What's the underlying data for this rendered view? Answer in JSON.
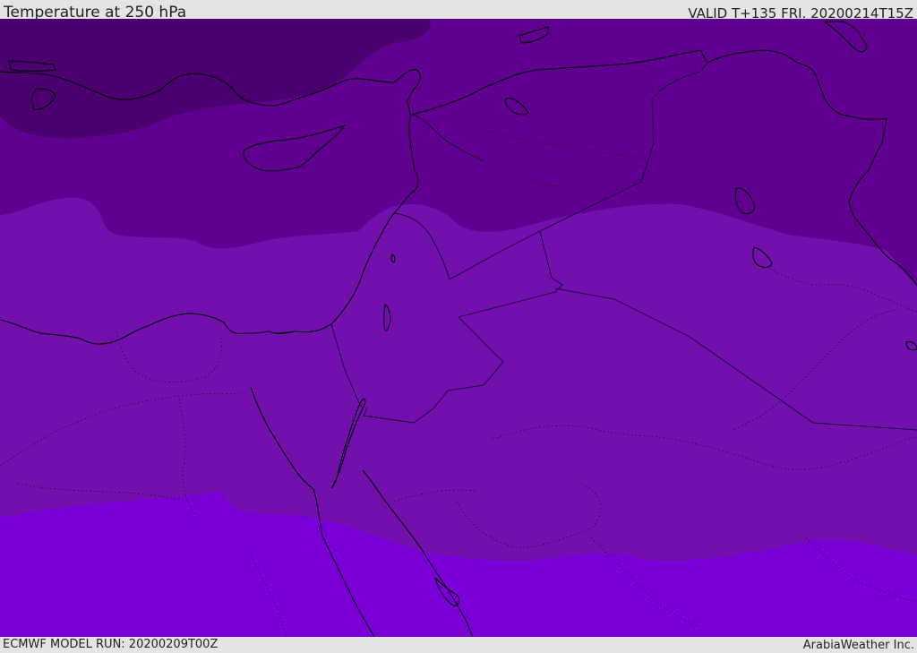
{
  "header": {
    "title": "Temperature at 250 hPa",
    "valid": "VALID T+135 FRI. 20200214T15Z"
  },
  "footer": {
    "model_run": "ECMWF MODEL RUN: 20200209T00Z",
    "credit": "ArabiaWeather Inc."
  },
  "map": {
    "field": "temperature",
    "level": "250 hPa",
    "colors": {
      "band_coldest": "#4b0070",
      "band_cold": "#600090",
      "band_mid": "#7210ae",
      "band_warm": "#7b00d8",
      "coastline": "#000000",
      "country_border": "#1a0030"
    }
  }
}
